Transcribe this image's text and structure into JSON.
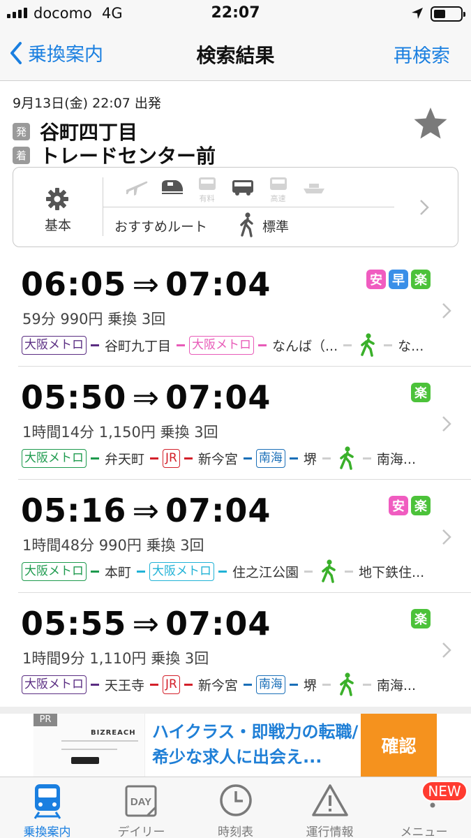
{
  "status_bar": {
    "carrier": "docomo",
    "network": "4G",
    "time": "22:07"
  },
  "nav": {
    "back_label": "乗換案内",
    "title": "検索結果",
    "research_label": "再検索"
  },
  "search": {
    "datetime": "9月13日(金) 22:07 出発",
    "from_tag": "発",
    "from": "谷町四丁目",
    "to_tag": "着",
    "to": "トレードセンター前",
    "conditions": {
      "basic_label": "基本",
      "mode_icons": [
        "airplane-icon",
        "shinkansen-icon",
        "limited-express-icon",
        "bus-icon",
        "highway-bus-icon",
        "ferry-icon"
      ],
      "mode_sublabels": {
        "limited_express": "有料",
        "highway_bus": "高速"
      },
      "route_type": "おすすめルート",
      "walk_speed": "標準"
    }
  },
  "routes": [
    {
      "depart": "06:05",
      "arrive": "07:04",
      "arrow": "⇒",
      "badges": [
        "安",
        "早",
        "楽"
      ],
      "summary": "59分 990円 乗換 3回",
      "legs": [
        {
          "type": "line",
          "label": "大阪メトロ",
          "color": "#5a2d82"
        },
        {
          "type": "station",
          "label": "谷町九丁目"
        },
        {
          "type": "line",
          "label": "大阪メトロ",
          "color": "#e85bb8"
        },
        {
          "type": "station",
          "label": "なんば（..."
        },
        {
          "type": "walk"
        },
        {
          "type": "station",
          "label": "な..."
        }
      ]
    },
    {
      "depart": "05:50",
      "arrive": "07:04",
      "arrow": "⇒",
      "badges": [
        "楽"
      ],
      "summary": "1時間14分 1,150円 乗換 3回",
      "legs": [
        {
          "type": "line",
          "label": "大阪メトロ",
          "color": "#1d9a4d"
        },
        {
          "type": "station",
          "label": "弁天町"
        },
        {
          "type": "line",
          "label": "JR",
          "color": "#d3202a"
        },
        {
          "type": "station",
          "label": "新今宮"
        },
        {
          "type": "line",
          "label": "南海",
          "color": "#1a6fb8"
        },
        {
          "type": "station",
          "label": "堺"
        },
        {
          "type": "walk"
        },
        {
          "type": "station",
          "label": "南海..."
        }
      ]
    },
    {
      "depart": "05:16",
      "arrive": "07:04",
      "arrow": "⇒",
      "badges": [
        "安",
        "楽"
      ],
      "summary": "1時間48分 990円 乗換 3回",
      "legs": [
        {
          "type": "line",
          "label": "大阪メトロ",
          "color": "#1d9a4d"
        },
        {
          "type": "station",
          "label": "本町"
        },
        {
          "type": "line",
          "label": "大阪メトロ",
          "color": "#20b2d6"
        },
        {
          "type": "station",
          "label": "住之江公園"
        },
        {
          "type": "walk"
        },
        {
          "type": "station",
          "label": "地下鉄住..."
        }
      ]
    },
    {
      "depart": "05:55",
      "arrive": "07:04",
      "arrow": "⇒",
      "badges": [
        "楽"
      ],
      "summary": "1時間9分 1,110円 乗換 3回",
      "legs": [
        {
          "type": "line",
          "label": "大阪メトロ",
          "color": "#5a2d82"
        },
        {
          "type": "station",
          "label": "天王寺"
        },
        {
          "type": "line",
          "label": "JR",
          "color": "#d3202a"
        },
        {
          "type": "station",
          "label": "新今宮"
        },
        {
          "type": "line",
          "label": "南海",
          "color": "#1a6fb8"
        },
        {
          "type": "station",
          "label": "堺"
        },
        {
          "type": "walk"
        },
        {
          "type": "station",
          "label": "南海..."
        }
      ]
    }
  ],
  "badge_colors": {
    "安": "#f05cc0",
    "早": "#3a8fe8",
    "楽": "#4cc23a"
  },
  "ad": {
    "pr_label": "PR",
    "brand": "BIZREACH",
    "text": "ハイクラス・即戦力の転職/希少な求人に出会え...",
    "button": "確認"
  },
  "tabs": [
    {
      "label": "乗換案内",
      "icon": "train-icon",
      "active": true
    },
    {
      "label": "デイリー",
      "icon": "daily-calendar-icon",
      "active": false,
      "icon_text": "DAY"
    },
    {
      "label": "時刻表",
      "icon": "clock-icon",
      "active": false
    },
    {
      "label": "運行情報",
      "icon": "warning-icon",
      "active": false
    },
    {
      "label": "メニュー",
      "icon": "more-icon",
      "active": false
    }
  ],
  "new_badge": "NEW",
  "colors": {
    "accent": "#1a7fe0",
    "walk_green": "#3ab02a"
  }
}
